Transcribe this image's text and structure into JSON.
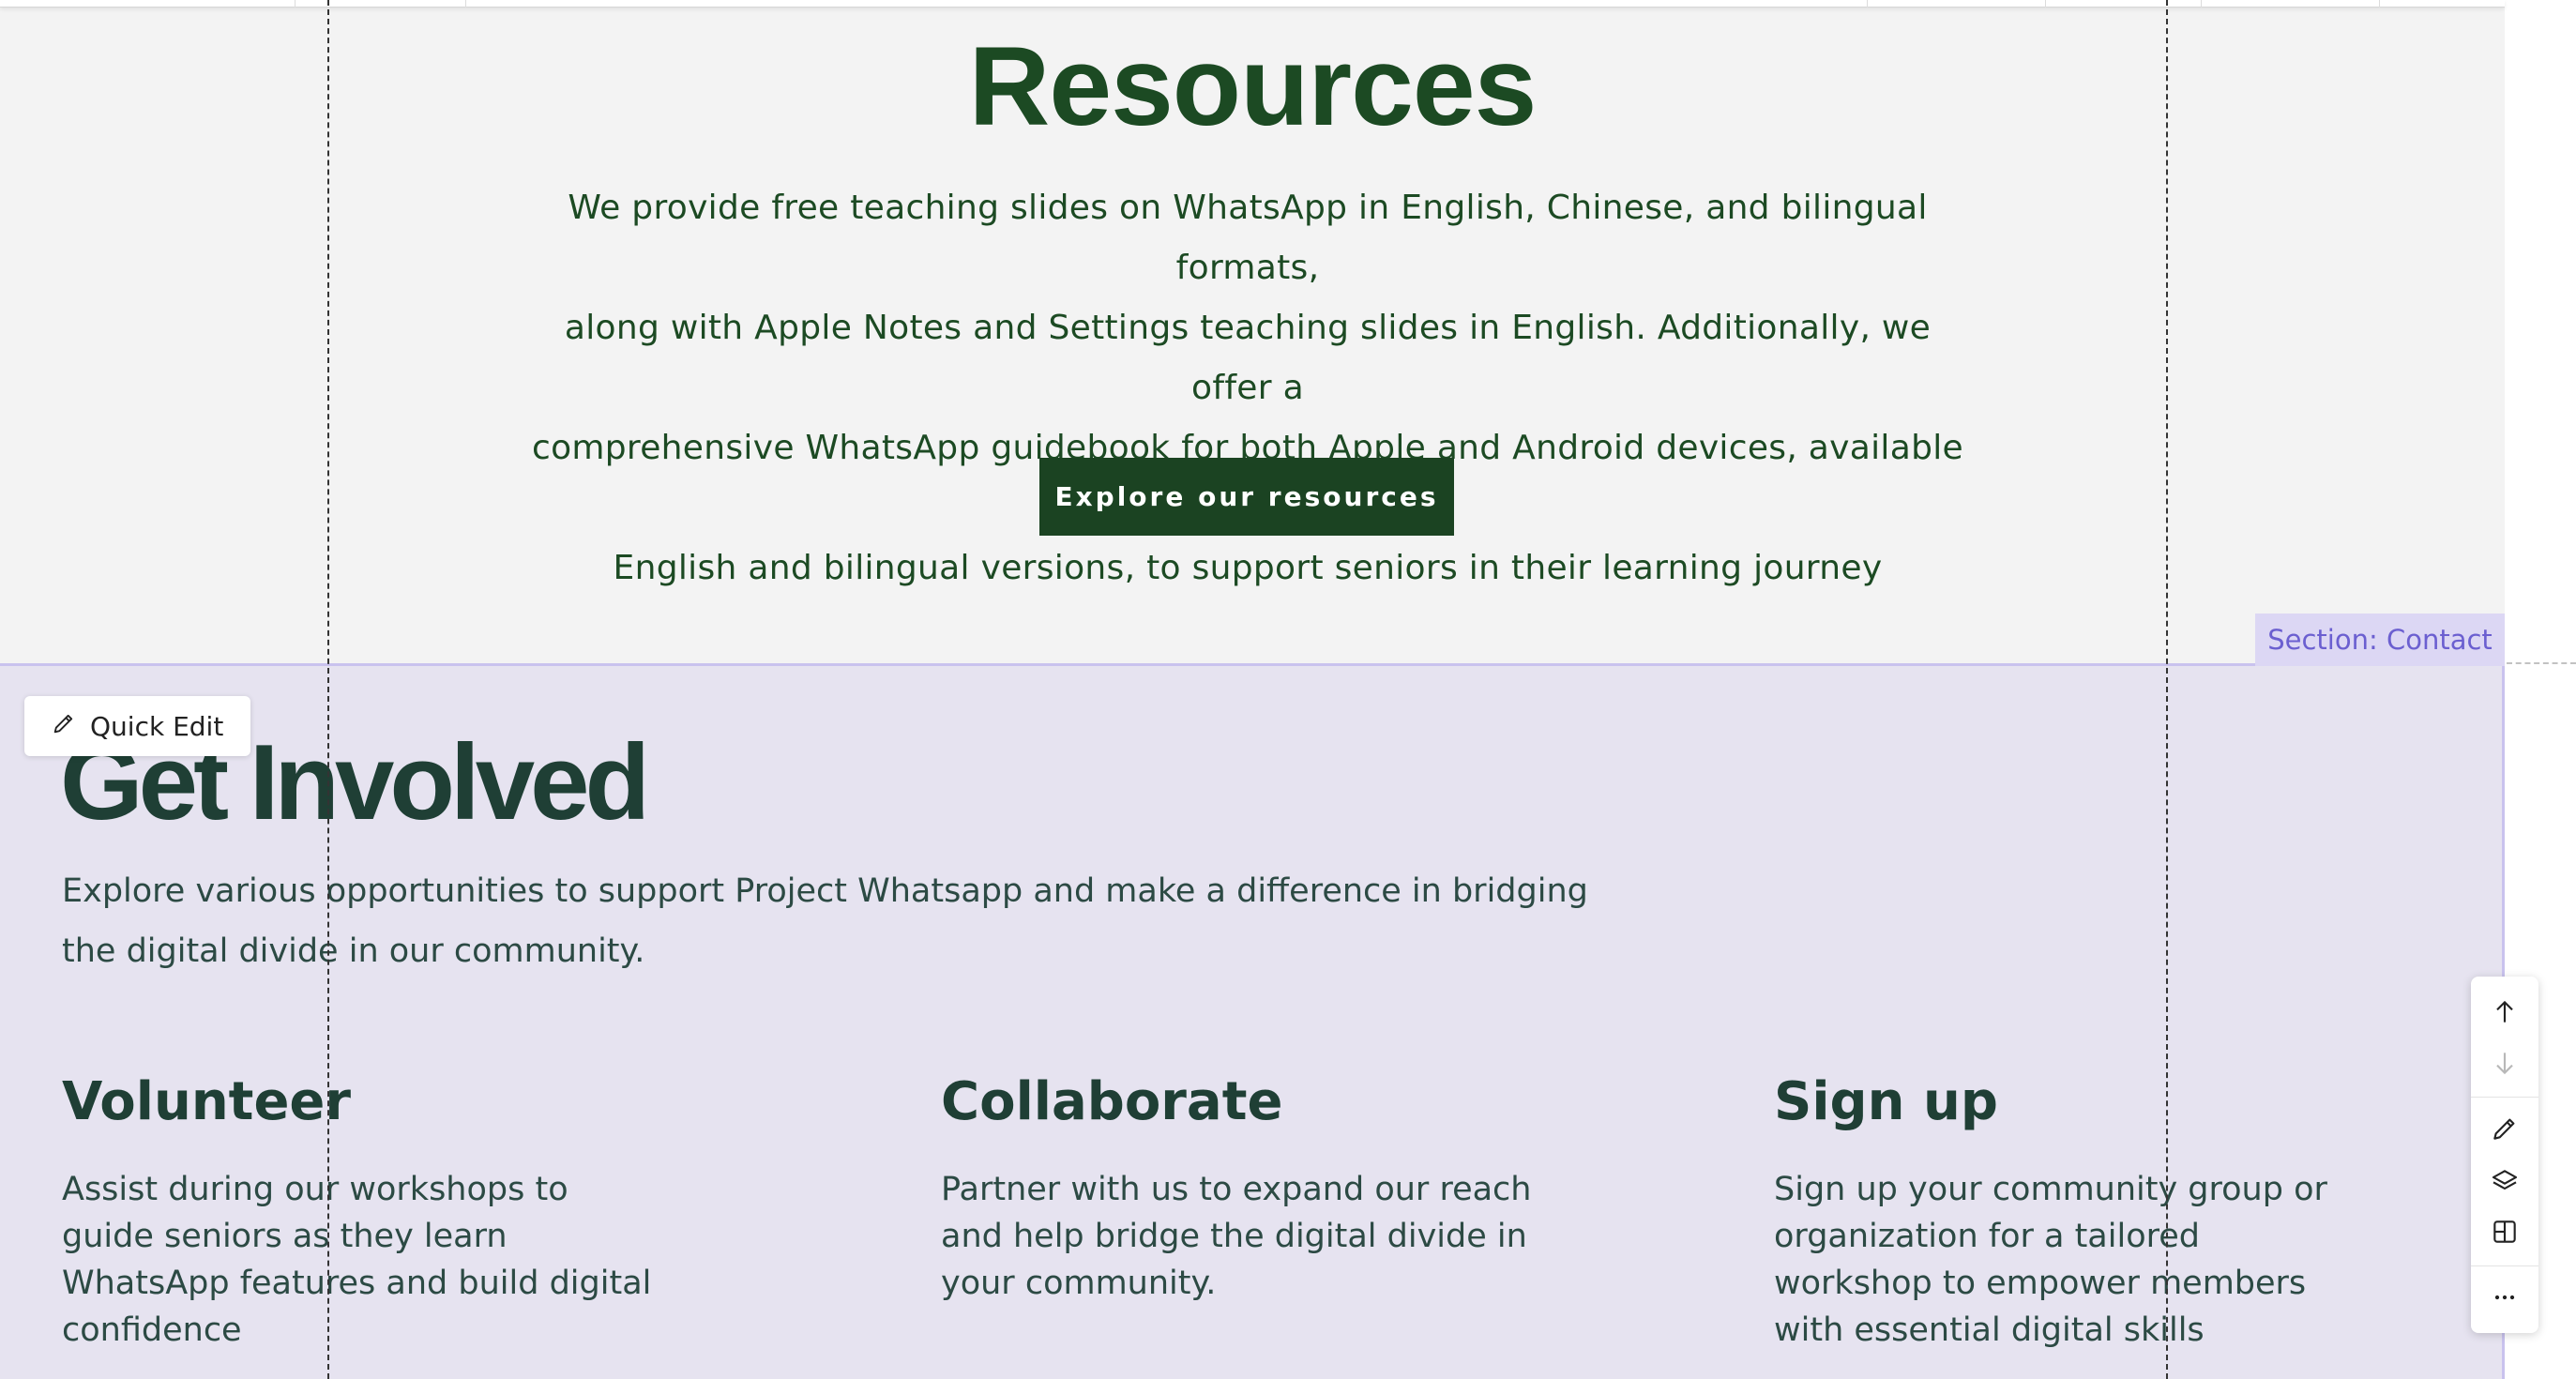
{
  "resources": {
    "title": "Resources",
    "body_lines": [
      "We provide free teaching slides on WhatsApp in English, Chinese, and bilingual formats,",
      "along with Apple Notes and Settings teaching slides in English. Additionally, we offer a",
      "comprehensive WhatsApp guidebook for both Apple and Android devices, available in",
      "English and bilingual versions, to support seniors in their learning journey"
    ],
    "button_label": "Explore our resources"
  },
  "contact": {
    "section_tag": "Section: Contact",
    "title": "Get Involved",
    "body_lines": [
      "Explore various opportunities to support Project Whatsapp and make a difference in bridging",
      "the digital divide in our community."
    ],
    "columns": [
      {
        "title": "Volunteer",
        "lines": [
          "Assist during our workshops to",
          "guide seniors as they learn",
          "WhatsApp features and build digital",
          "confidence"
        ]
      },
      {
        "title": "Collaborate",
        "lines": [
          "Partner with us to expand our reach",
          "and help bridge the digital divide in",
          "your community."
        ]
      },
      {
        "title": "Sign up",
        "lines": [
          "Sign up your community group or",
          "organization for a tailored",
          "workshop to empower members",
          "with essential digital skills"
        ]
      }
    ]
  },
  "editor": {
    "quick_edit_label": "Quick Edit",
    "toolbar_icons": [
      "arrow-up-icon",
      "arrow-down-icon",
      "pencil-icon",
      "layers-icon",
      "layout-icon",
      "more-icon"
    ]
  },
  "colors": {
    "brand_green": "#1b4322",
    "contact_bg": "#e6e3f0",
    "section_tag_text": "#6b5fd0"
  }
}
